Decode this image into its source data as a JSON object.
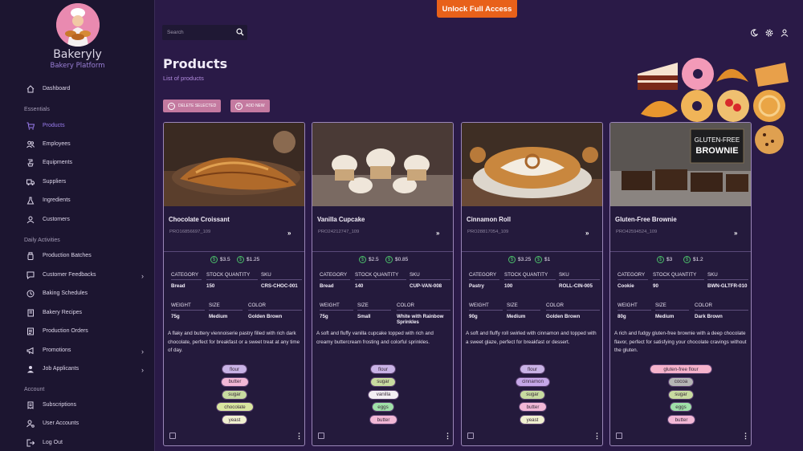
{
  "app": {
    "name": "Bakeryly",
    "subtitle": "Bakery Platform"
  },
  "topbar": {
    "cta": "Unlock Full Access",
    "search_placeholder": "Search"
  },
  "sidebar": {
    "dashboard": "Dashboard",
    "sections": {
      "essentials": "Essentials",
      "daily": "Daily Activities",
      "account": "Account"
    },
    "essentials": [
      "Products",
      "Employees",
      "Equipments",
      "Suppliers",
      "Ingredients",
      "Customers"
    ],
    "daily": [
      "Production Batches",
      "Customer Feedbacks",
      "Baking Schedules",
      "Bakery Recipes",
      "Production Orders",
      "Promotions",
      "Job Applicants"
    ],
    "account": [
      "Subscriptions",
      "User Accounts",
      "Log Out"
    ]
  },
  "page": {
    "title": "Products",
    "subtitle": "List of products",
    "delete_label": "DELETE SELECTED",
    "add_label": "ADD NEW"
  },
  "labels": {
    "category": "CATEGORY",
    "stock": "STOCK QUANTITY",
    "sku": "SKU",
    "weight": "WEIGHT",
    "size": "SIZE",
    "color": "COLOR"
  },
  "products": [
    {
      "name": "Chocolate Croissant",
      "code": "PRO16856697_109",
      "price1": "$3.5",
      "price2": "$1.25",
      "category": "Bread",
      "stock": "150",
      "sku": "CRS-CHOC-001",
      "weight": "75g",
      "size": "Medium",
      "color": "Golden Brown",
      "description": "A flaky and buttery viennoiserie pastry filled with rich dark chocolate, perfect for breakfast or a sweet treat at any time of day.",
      "tags": [
        "flour",
        "butter",
        "sugar",
        "chocolate",
        "yeast"
      ]
    },
    {
      "name": "Vanilla Cupcake",
      "code": "PRO24212747_109",
      "price1": "$2.5",
      "price2": "$0.85",
      "category": "Bread",
      "stock": "140",
      "sku": "CUP-VAN-008",
      "weight": "75g",
      "size": "Small",
      "color": "White with Rainbow Sprinkles",
      "description": "A soft and fluffy vanilla cupcake topped with rich and creamy buttercream frosting and colorful sprinkles.",
      "tags": [
        "flour",
        "sugar",
        "vanilla",
        "eggs",
        "butter"
      ]
    },
    {
      "name": "Cinnamon Roll",
      "code": "PRO28817054_109",
      "price1": "$3.25",
      "price2": "$1",
      "category": "Pastry",
      "stock": "100",
      "sku": "ROLL-CIN-005",
      "weight": "90g",
      "size": "Medium",
      "color": "Golden Brown",
      "description": "A soft and fluffy roll swirled with cinnamon and topped with a sweet glaze, perfect for breakfast or dessert.",
      "tags": [
        "flour",
        "cinnamon",
        "sugar",
        "butter",
        "yeast"
      ]
    },
    {
      "name": "Gluten-Free Brownie",
      "code": "PRO42594524_109",
      "price1": "$3",
      "price2": "$1.2",
      "category": "Cookie",
      "stock": "90",
      "sku": "BWN-GLTFR-010",
      "weight": "80g",
      "size": "Medium",
      "color": "Dark Brown",
      "description": "A rich and fudgy gluten-free brownie with a deep chocolate flavor, perfect for satisfying your chocolate cravings without the gluten.",
      "tags": [
        "gluten-free flour",
        "cocoa",
        "sugar",
        "eggs",
        "butter"
      ],
      "image_text": [
        "GLUTEN-FREE",
        "BROWNIE"
      ]
    }
  ],
  "tag_colors": {
    "flour": "#c9b3e6",
    "butter": "#f2b8d6",
    "sugar": "#c8dba0",
    "chocolate": "#d9e6a0",
    "yeast": "#f0f0d0",
    "vanilla": "#f3eef3",
    "eggs": "#9fe0a8",
    "cinnamon": "#c6a7e8",
    "gluten-free flour": "#f6b3cc",
    "cocoa": "#b5b5b5"
  }
}
